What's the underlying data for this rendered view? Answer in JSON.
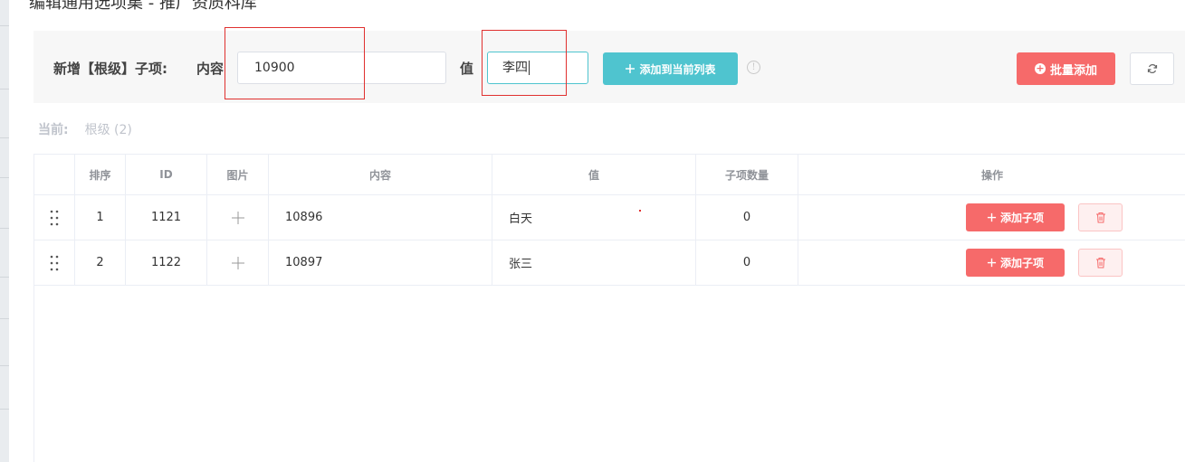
{
  "dialog": {
    "title": "编辑通用选项集 - 推广资质科库"
  },
  "toolbar": {
    "title": "新增【根级】子项:",
    "content_label": "内容",
    "content_value": "10900",
    "value_label": "值",
    "value_value": "李四",
    "add_to_list_label": "添加到当前列表",
    "info_icon": "info-icon",
    "batch_add_label": "批量添加",
    "refresh_icon": "refresh-icon"
  },
  "breadcrumb": {
    "label": "当前:",
    "path": "根级 (2)"
  },
  "table": {
    "headers": {
      "drag": "",
      "order": "排序",
      "id": "ID",
      "image": "图片",
      "content": "内容",
      "value": "值",
      "child_count": "子项数量",
      "actions": "操作"
    },
    "rows": [
      {
        "order": "1",
        "id": "1121",
        "content": "10896",
        "value": "白天",
        "child_count": "0",
        "add_child_label": "添加子项"
      },
      {
        "order": "2",
        "id": "1122",
        "content": "10897",
        "value": "张三",
        "child_count": "0",
        "add_child_label": "添加子项"
      }
    ]
  },
  "colors": {
    "primary_teal": "#4fc4cf",
    "danger_red": "#f66a6a",
    "annotation_red": "#e0302f"
  }
}
